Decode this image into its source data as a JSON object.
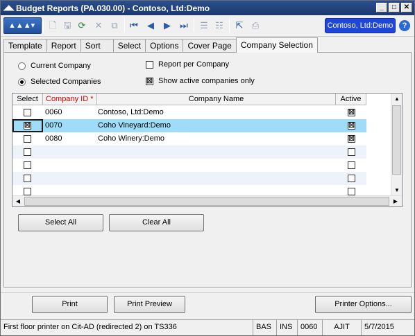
{
  "window": {
    "title": "Budget Reports (PA.030.00) - Contoso, Ltd:Demo",
    "minimize": "_",
    "maximize": "□",
    "close": "✕"
  },
  "toolbar": {
    "logo_label": "▲▲▲▾",
    "company": "Contoso, Ltd:Demo",
    "help": "?"
  },
  "tabs": [
    {
      "label": "Template"
    },
    {
      "label": "Report"
    },
    {
      "label": "Sort"
    },
    {
      "label": "Select"
    },
    {
      "label": "Options"
    },
    {
      "label": "Cover Page"
    },
    {
      "label": "Company Selection"
    }
  ],
  "options": {
    "current_company": "Current Company",
    "selected_companies": "Selected Companies",
    "report_per_company": "Report per Company",
    "show_active_only": "Show active companies only",
    "show_active_checked": "☒"
  },
  "grid": {
    "headers": [
      "Select",
      "Company ID *",
      "Company Name",
      "Active"
    ],
    "rows": [
      {
        "select": "",
        "id": "0060",
        "name": "Contoso, Ltd:Demo",
        "active": "☒"
      },
      {
        "select": "☒",
        "id": "0070",
        "name": "Coho Vineyard:Demo",
        "active": "☒"
      },
      {
        "select": "",
        "id": "0080",
        "name": "Coho Winery:Demo",
        "active": "☒"
      },
      {
        "select": "",
        "id": "",
        "name": "",
        "active": ""
      },
      {
        "select": "",
        "id": "",
        "name": "",
        "active": ""
      },
      {
        "select": "",
        "id": "",
        "name": "",
        "active": ""
      },
      {
        "select": "",
        "id": "",
        "name": "",
        "active": ""
      }
    ]
  },
  "buttons": {
    "select_all": "Select All",
    "clear_all": "Clear All",
    "print": "Print",
    "print_preview": "Print Preview",
    "printer_options": "Printer Options..."
  },
  "status": {
    "printer": "First floor printer on Cit-AD (redirected 2) on TS336",
    "mode": "BAS",
    "ins": "INS",
    "company": "0060",
    "user": "AJIT",
    "date": "5/7/2015"
  }
}
